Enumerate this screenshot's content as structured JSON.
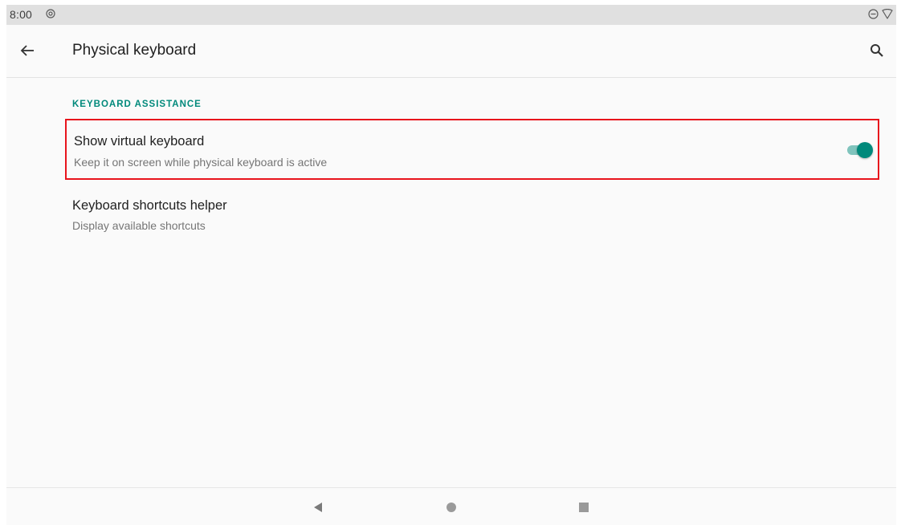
{
  "status_bar": {
    "time": "8:00",
    "notification_icon": "at-sign-icon",
    "right_icons": [
      "dnd-icon",
      "wifi-icon"
    ]
  },
  "app_bar": {
    "back_icon": "arrow-back-icon",
    "title": "Physical keyboard",
    "search_icon": "search-icon"
  },
  "section": {
    "header": "KEYBOARD ASSISTANCE"
  },
  "preferences": [
    {
      "title": "Show virtual keyboard",
      "summary": "Keep it on screen while physical keyboard is active",
      "toggle_on": true
    },
    {
      "title": "Keyboard shortcuts helper",
      "summary": "Display available shortcuts"
    }
  ],
  "nav_bar": {
    "back": "nav-back-icon",
    "home": "nav-home-icon",
    "recents": "nav-recents-icon"
  },
  "colors": {
    "accent": "#00897b",
    "highlight": "#e8141c"
  }
}
